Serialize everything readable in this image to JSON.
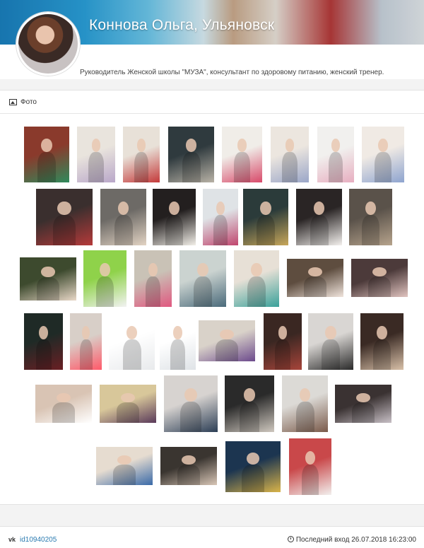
{
  "profile": {
    "name": "Коннова Ольга, Ульяновск",
    "bio": "Руководитель Женской школы \"МУЗА\", консультант по здоровому питанию, женский тренер."
  },
  "photos_section": {
    "title": "Фото",
    "icon": "image-icon"
  },
  "footer": {
    "vk_label": "vk",
    "vk_id": "id10940205",
    "last_seen": "Последний вход 26.07.2018 16:23:00"
  },
  "colors": {
    "link": "#2a7ab0",
    "text": "#333333",
    "background": "#f3f3f3"
  },
  "photos": [
    {
      "alt": "photo-1"
    },
    {
      "alt": "photo-2"
    },
    {
      "alt": "photo-3"
    },
    {
      "alt": "photo-4"
    },
    {
      "alt": "photo-5"
    },
    {
      "alt": "photo-6"
    },
    {
      "alt": "photo-7"
    },
    {
      "alt": "photo-8"
    },
    {
      "alt": "photo-9"
    },
    {
      "alt": "photo-10"
    },
    {
      "alt": "photo-11"
    },
    {
      "alt": "photo-12"
    },
    {
      "alt": "photo-13"
    },
    {
      "alt": "photo-14"
    },
    {
      "alt": "photo-15"
    },
    {
      "alt": "photo-16"
    },
    {
      "alt": "photo-17"
    },
    {
      "alt": "photo-18"
    },
    {
      "alt": "photo-19"
    },
    {
      "alt": "photo-20"
    },
    {
      "alt": "photo-21"
    },
    {
      "alt": "photo-22"
    },
    {
      "alt": "photo-23"
    },
    {
      "alt": "photo-24"
    },
    {
      "alt": "photo-25"
    },
    {
      "alt": "photo-26"
    },
    {
      "alt": "photo-27"
    },
    {
      "alt": "photo-28"
    },
    {
      "alt": "photo-29"
    },
    {
      "alt": "photo-30"
    },
    {
      "alt": "photo-31"
    },
    {
      "alt": "photo-32"
    },
    {
      "alt": "photo-33"
    },
    {
      "alt": "photo-34"
    },
    {
      "alt": "photo-35"
    },
    {
      "alt": "photo-36"
    },
    {
      "alt": "photo-37"
    },
    {
      "alt": "photo-38"
    },
    {
      "alt": "photo-39"
    },
    {
      "alt": "photo-40"
    },
    {
      "alt": "photo-41"
    }
  ]
}
